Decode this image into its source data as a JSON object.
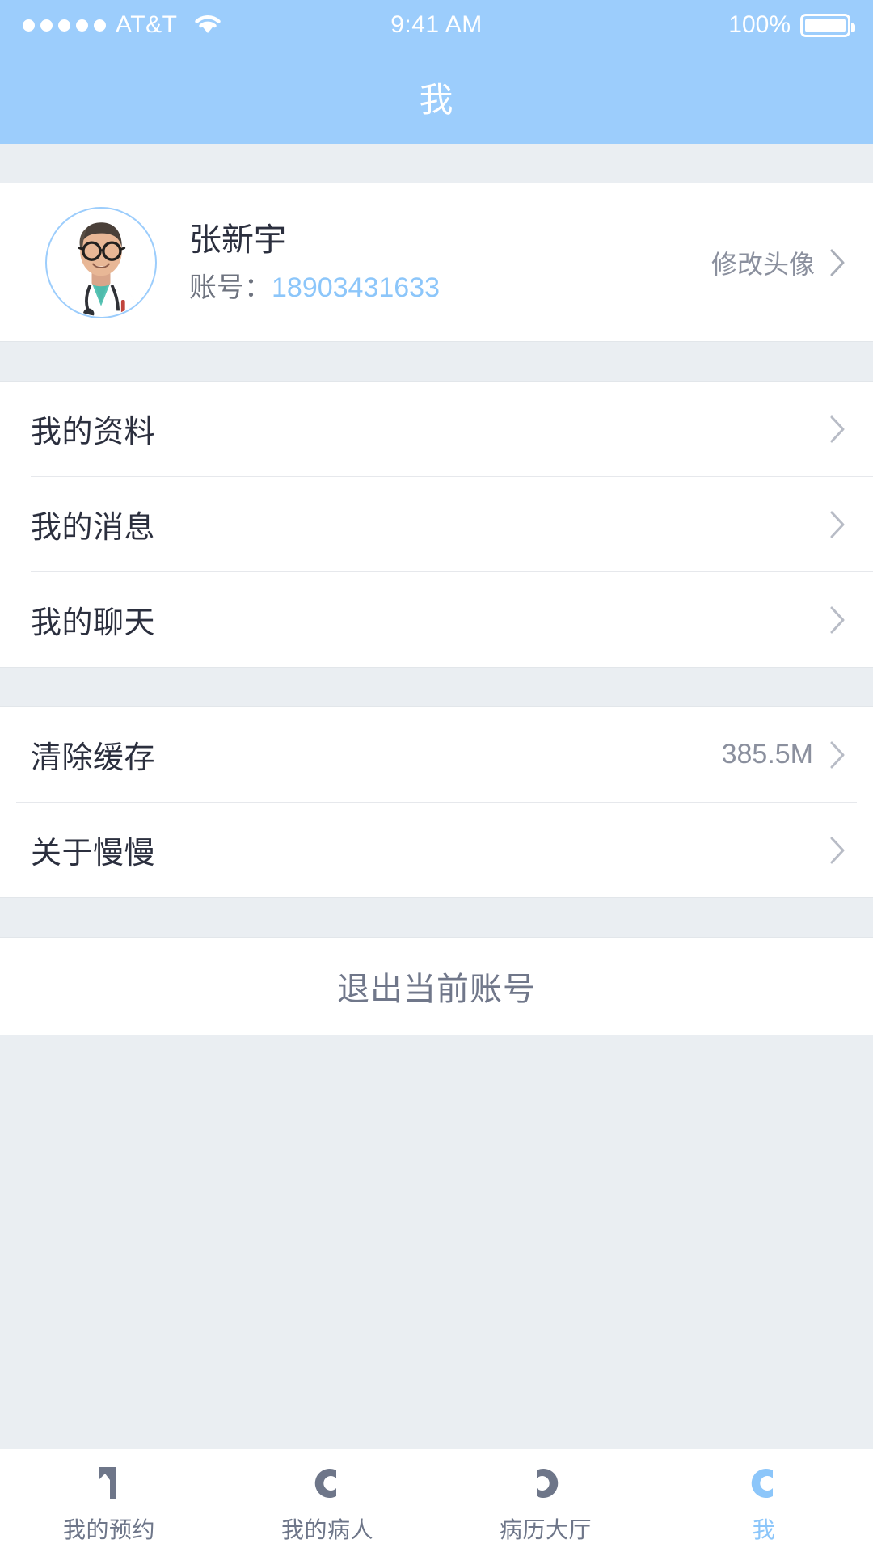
{
  "statusbar": {
    "carrier": "AT&T",
    "signal_dots": 5,
    "wifi_icon": "wifi-icon",
    "time": "9:41 AM",
    "battery_percent": "100%",
    "battery_icon": "battery-full-icon"
  },
  "header": {
    "title": "我",
    "background_color": "#9CCDFC"
  },
  "profile": {
    "avatar_name": "doctor-avatar",
    "name": "张新宇",
    "account_label": "账号：",
    "account_number": "18903431633",
    "account_number_color": "#8CC6FA",
    "edit_avatar_label": "修改头像",
    "chevron_icon": "chevron-right-icon"
  },
  "menu_group_1": {
    "items": [
      {
        "label": "我的资料",
        "icon": "chevron-right-icon"
      },
      {
        "label": "我的消息",
        "icon": "chevron-right-icon"
      },
      {
        "label": "我的聊天",
        "icon": "chevron-right-icon"
      }
    ]
  },
  "menu_group_2": {
    "items": [
      {
        "label": "清除缓存",
        "value": "385.5M",
        "icon": "chevron-right-icon"
      },
      {
        "label": "关于慢慢",
        "value": "",
        "icon": "chevron-right-icon"
      }
    ]
  },
  "logout": {
    "label": "退出当前账号"
  },
  "tabbar": {
    "active_color": "#8CC6FA",
    "inactive_color": "#6E7689",
    "tabs": [
      {
        "label": "我的预约",
        "icon": "calendar-flag-icon",
        "active": false
      },
      {
        "label": "我的病人",
        "icon": "patient-arc-icon",
        "active": false
      },
      {
        "label": "病历大厅",
        "icon": "records-arc-icon",
        "active": false
      },
      {
        "label": "我",
        "icon": "profile-arc-icon",
        "active": true
      }
    ]
  }
}
